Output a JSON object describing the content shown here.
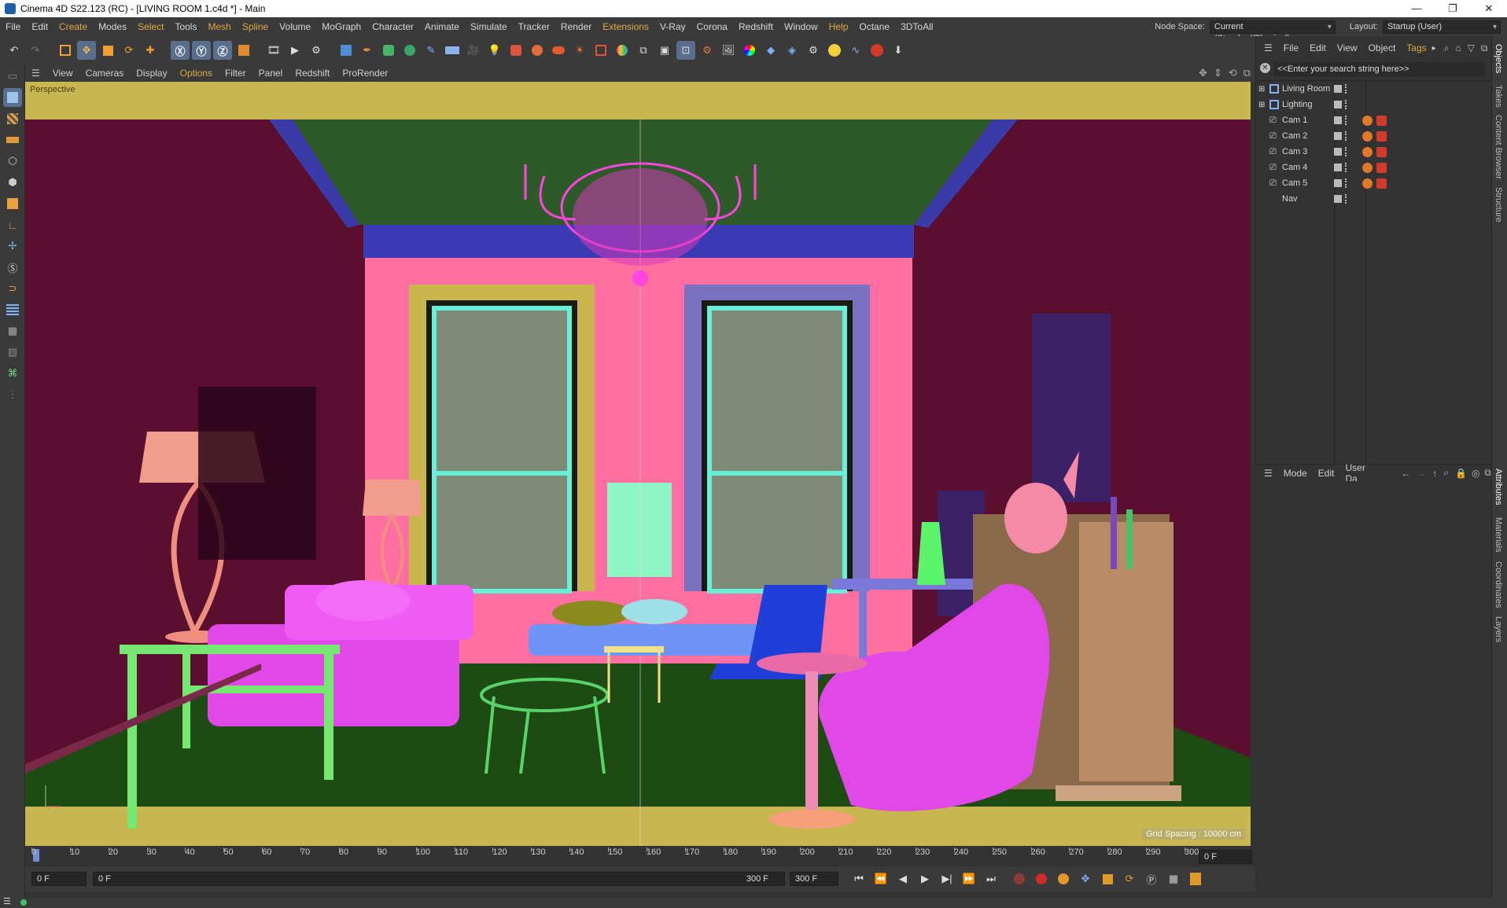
{
  "window": {
    "title": "Cinema 4D S22.123 (RC) - [LIVING ROOM 1.c4d *] - Main",
    "controls": [
      "—",
      "❐",
      "✕"
    ]
  },
  "menubar": {
    "items": [
      "File",
      "Edit",
      "Create",
      "Modes",
      "Select",
      "Tools",
      "Mesh",
      "Spline",
      "Volume",
      "MoGraph",
      "Character",
      "Animate",
      "Simulate",
      "Tracker",
      "Render",
      "Extensions",
      "V-Ray",
      "Corona",
      "Redshift",
      "Window",
      "Help",
      "Octane",
      "3DToAll"
    ],
    "highlighted": [
      "Create",
      "Select",
      "Mesh",
      "Spline",
      "Extensions",
      "Help"
    ],
    "node_space_label": "Node Space:",
    "node_space_value": "Current (Standard/Physical)",
    "layout_label": "Layout:",
    "layout_value": "Startup (User)"
  },
  "viewport": {
    "menu": [
      "View",
      "Cameras",
      "Display",
      "Options",
      "Filter",
      "Panel",
      "Redshift",
      "ProRender"
    ],
    "highlighted": "Options",
    "label": "Perspective",
    "grid_info": "Grid Spacing : 10000 cm"
  },
  "timeline": {
    "ticks": [
      "0",
      "10",
      "20",
      "30",
      "40",
      "50",
      "60",
      "70",
      "80",
      "90",
      "100",
      "110",
      "120",
      "130",
      "140",
      "150",
      "160",
      "170",
      "180",
      "190",
      "200",
      "210",
      "220",
      "230",
      "240",
      "250",
      "260",
      "270",
      "280",
      "290",
      "300"
    ],
    "current_frame_right": "0 F",
    "start_field": "0 F",
    "range_start": "0 F",
    "range_end": "300 F",
    "end_field": "300 F"
  },
  "objects_panel": {
    "menu": [
      "File",
      "Edit",
      "View",
      "Object",
      "Tags"
    ],
    "search_placeholder": "<<Enter your search string here>>",
    "items": [
      {
        "name": "Living Room",
        "type": "null"
      },
      {
        "name": "Lighting",
        "type": "null"
      },
      {
        "name": "Cam 1",
        "type": "camera"
      },
      {
        "name": "Cam 2",
        "type": "camera"
      },
      {
        "name": "Cam 3",
        "type": "camera"
      },
      {
        "name": "Cam 4",
        "type": "camera"
      },
      {
        "name": "Cam 5",
        "type": "camera"
      },
      {
        "name": "Nav",
        "type": "camera"
      }
    ]
  },
  "attributes_panel": {
    "menu": [
      "Mode",
      "Edit",
      "User Da"
    ]
  },
  "side_tabs": {
    "top": [
      "Objects",
      "Takes",
      "Content Browser",
      "Structure"
    ],
    "bottom": [
      "Attributes",
      "Materials",
      "Coordinates",
      "Layers"
    ]
  },
  "colors": {
    "ui_bg": "#3a3a3a",
    "accent": "#e0a843",
    "viewport_frame": "#c8b650",
    "wall_back": "#ff6fa0",
    "wall_side": "#5a0f2e",
    "floor": "#1e4a14"
  }
}
